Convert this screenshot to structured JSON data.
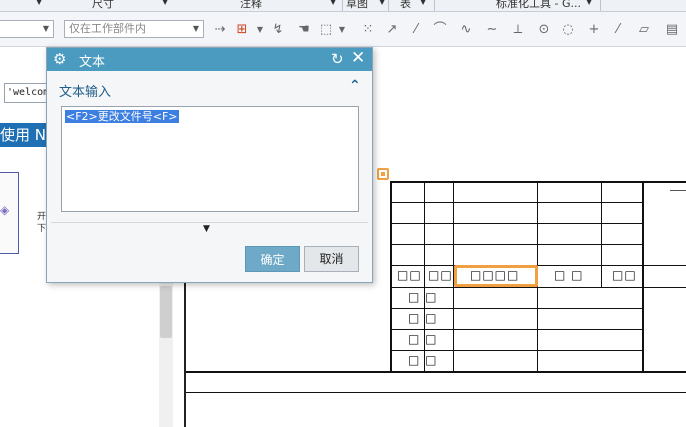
{
  "menu": {
    "items": [
      {
        "label": "尺寸"
      },
      {
        "label": "注释"
      },
      {
        "label": "草图"
      },
      {
        "label": "表"
      },
      {
        "label": "标准化工具 - G..."
      }
    ]
  },
  "toolbar": {
    "combo_left_value": "",
    "filter_combo_value": "仅在工作部件内"
  },
  "left": {
    "welcome_text": "'welcom",
    "banner_text": "使用 NX",
    "side_text_1": "开",
    "side_text_2": "下"
  },
  "dialog": {
    "title": "文本",
    "section_title": "文本输入",
    "text_value": "<F2>更改文件号<F>",
    "ok_label": "确定",
    "cancel_label": "取消"
  },
  "drawing": {
    "header_cells": [
      "□□",
      "□□",
      "□□□□",
      "□ □",
      "□□"
    ],
    "row_cells": [
      "□ □",
      "□ □",
      "□ □",
      "□ □"
    ]
  },
  "icons": {
    "gear": "gear-icon",
    "reset": "reset-icon",
    "close": "close-icon",
    "collapse": "chevron-up-icon",
    "expand": "chevron-down-icon"
  },
  "colors": {
    "titlebar": "#4b9bc0",
    "selection": "#3d7fe0",
    "highlight": "#f0a040",
    "ok_button": "#6fa9c8"
  }
}
